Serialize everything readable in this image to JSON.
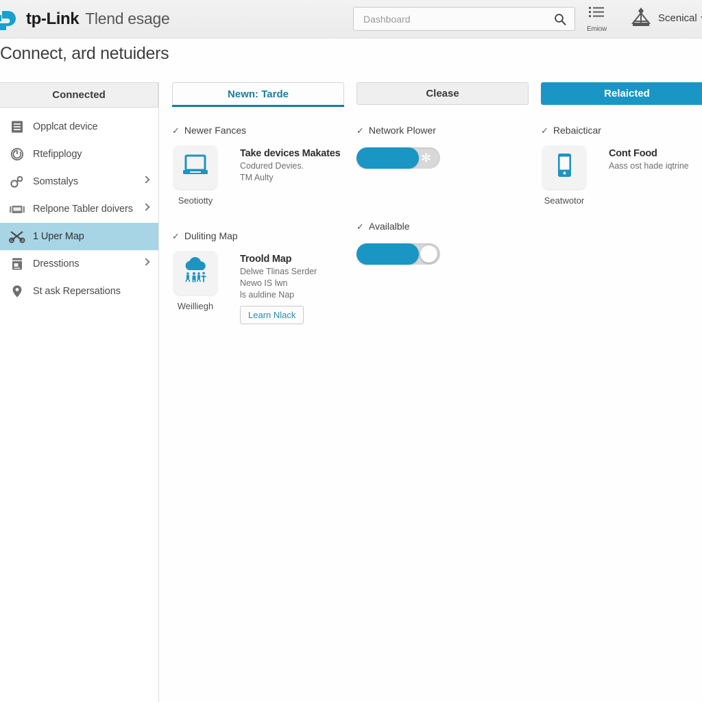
{
  "header": {
    "brand_name": "tp-Link",
    "brand_sub": "Tlend esage",
    "logo_icon": "tplink-logo-icon",
    "search": {
      "value": "Dashboard",
      "placeholder": "Dashboard",
      "icon": "search-icon"
    },
    "tools": [
      {
        "icon": "list-lines-icon",
        "label": "Emiow"
      }
    ],
    "avatar_icon": "avatar-icon",
    "user_label": "Scenical",
    "caret_icon": "chevron-down-icon"
  },
  "page": {
    "title": "Connect, ard netuiders"
  },
  "sidebar": {
    "header": "Connected",
    "items": [
      {
        "label": "Opplcat device",
        "icon": "document-icon",
        "chevron": false,
        "active": false
      },
      {
        "label": "Rtefipplogy",
        "icon": "circle-arrow-icon",
        "chevron": false,
        "active": false
      },
      {
        "label": "Somstalys",
        "icon": "nodes-icon",
        "chevron": true,
        "active": false
      },
      {
        "label": "Relpone Tabler doivers",
        "icon": "server-rack-icon",
        "chevron": true,
        "active": false
      },
      {
        "label": "1 Uper Map",
        "icon": "scissors-icon",
        "chevron": false,
        "active": true
      },
      {
        "label": "Dresstions",
        "icon": "book-icon",
        "chevron": true,
        "active": false
      },
      {
        "label": "St ask Repersations",
        "icon": "map-pin-icon",
        "chevron": false,
        "active": false
      }
    ]
  },
  "columns": [
    {
      "tab": {
        "label": "Newn: Tarde",
        "style": "active"
      },
      "sections": [
        {
          "title": "Newer Fances",
          "check": "✓",
          "tile": {
            "icon": "laptop-icon",
            "caption": "Seotiotty",
            "title": "Take devices Makates",
            "lines": [
              "Codured Devies.",
              "TM Aulty"
            ],
            "button": null
          }
        },
        {
          "title": "Duliting Map",
          "check": "✓",
          "tile": {
            "icon": "cloud-people-icon",
            "caption": "Weilliegh",
            "title": "Troold Map",
            "lines": [
              "Delwe Tlinas Serder",
              "Newo IS lwn",
              "ls auldine Nap"
            ],
            "button": "Learn Nlack"
          }
        }
      ]
    },
    {
      "tab": {
        "label": "Clease",
        "style": "secondary"
      },
      "sections": [
        {
          "title": "Network Plower",
          "check": "✓",
          "toggle": {
            "state": "on",
            "knob": "asterisk",
            "glyph": "✻"
          }
        },
        {
          "title": "Availalble",
          "check": "✓",
          "toggle": {
            "state": "on",
            "knob": "circle",
            "glyph": ""
          }
        }
      ]
    },
    {
      "tab": {
        "label": "Relaicted",
        "style": "primary"
      },
      "sections": [
        {
          "title": "Rebaicticar",
          "check": "✓",
          "tile": {
            "icon": "phone-icon",
            "caption": "Seatwotor",
            "title": "Cont Food",
            "lines": [
              "Aass ost hade iqtrine"
            ],
            "button": null
          }
        }
      ]
    }
  ],
  "colors": {
    "accent": "#1a96c4",
    "accent_dark": "#10809f",
    "active_row": "#a8d5e5",
    "header_bg": "#ebebeb",
    "icon_gray": "#6f6f6f"
  }
}
